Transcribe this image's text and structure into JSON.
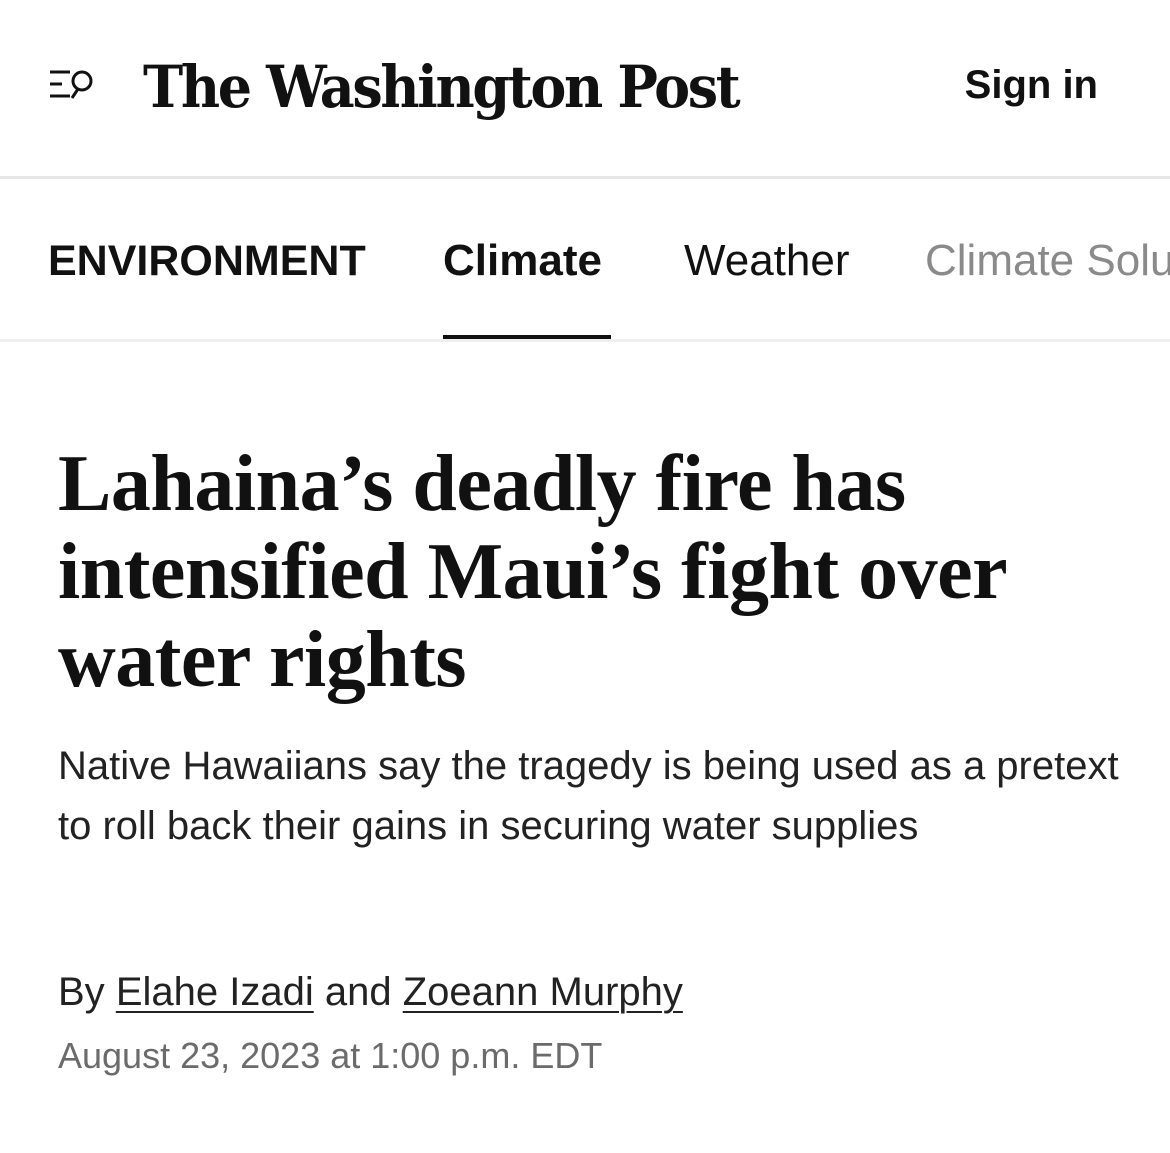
{
  "header": {
    "menu_icon": "menu-search-icon",
    "masthead": "The Washington Post",
    "sign_in_label": "Sign in"
  },
  "section_nav": {
    "section_label": "ENVIRONMENT",
    "items": [
      {
        "label": "Climate",
        "active": true
      },
      {
        "label": "Weather",
        "active": false
      },
      {
        "label": "Climate Solu",
        "active": false
      }
    ]
  },
  "article": {
    "headline": "Lahaina’s deadly fire has intensified Maui’s fight over water rights",
    "dek": "Native Hawaiians say the tragedy is being used as a pretext to roll back their gains in securing water supplies",
    "byline": {
      "prefix": "By",
      "author_1": "Elahe Izadi",
      "conjunction": "and",
      "author_2": "Zoeann Murphy"
    },
    "dateline": "August 23, 2023 at 1:00 p.m. EDT"
  },
  "colors": {
    "text": "#111111",
    "muted": "#6b6b6b",
    "inactive_nav": "#8a8a8a",
    "divider": "#e6e6e6"
  }
}
